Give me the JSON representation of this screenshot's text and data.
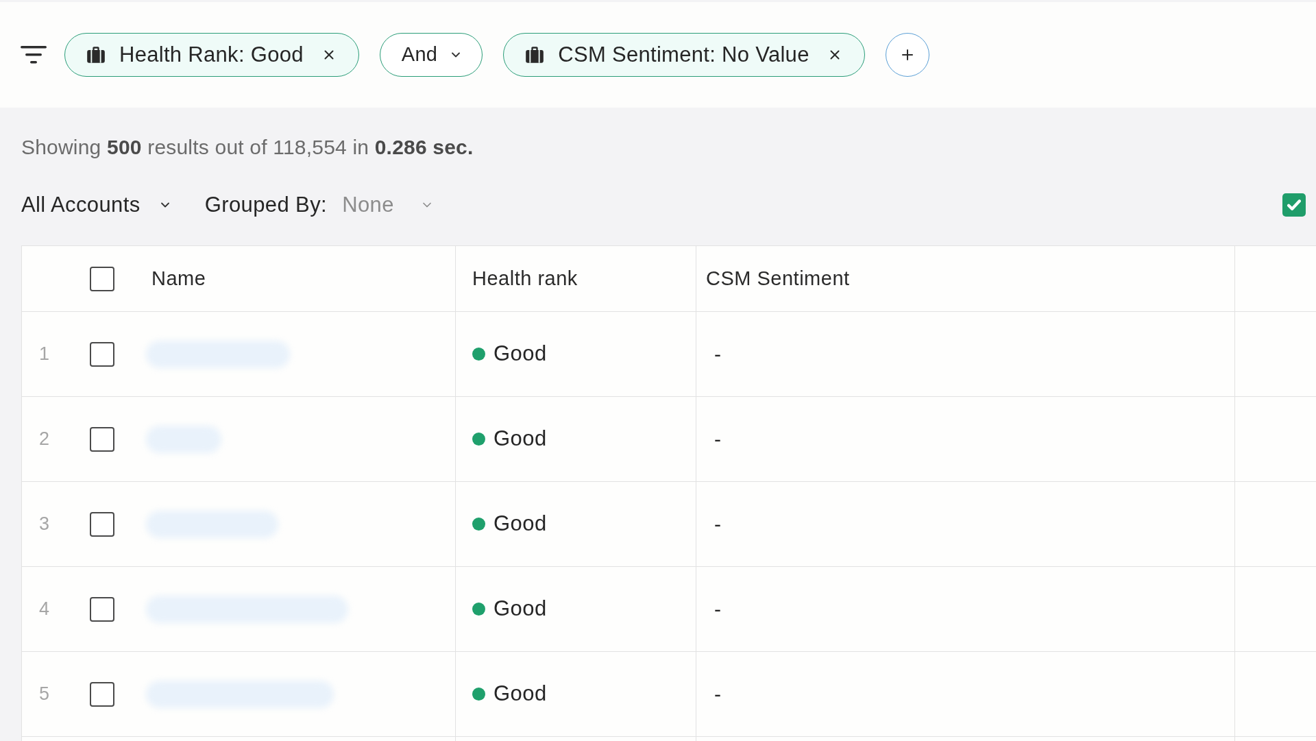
{
  "filter_bar": {
    "filters": [
      {
        "kind": "condition",
        "label": "Health Rank: Good"
      },
      {
        "kind": "operator",
        "label": "And"
      },
      {
        "kind": "condition",
        "label": "CSM Sentiment: No Value"
      }
    ]
  },
  "results_summary": "Showing **500** results out of 118,554 in **0.286 sec.**",
  "view_selector": {
    "label": "All Accounts"
  },
  "grouping": {
    "label": "Grouped By:",
    "value": "None"
  },
  "column_toggle": {
    "checked": true
  },
  "table": {
    "select_all": {
      "checked": false
    },
    "columns": [
      "Name",
      "Health rank",
      "CSM Sentiment"
    ],
    "rows": [
      {
        "index": "1",
        "checked": false,
        "health_rank": {
          "label": "Good",
          "color": "#1fa06c"
        },
        "csm_sentiment": "-"
      },
      {
        "index": "2",
        "checked": false,
        "health_rank": {
          "label": "Good",
          "color": "#1fa06c"
        },
        "csm_sentiment": "-"
      },
      {
        "index": "3",
        "checked": false,
        "health_rank": {
          "label": "Good",
          "color": "#1fa06c"
        },
        "csm_sentiment": "-"
      },
      {
        "index": "4",
        "checked": false,
        "health_rank": {
          "label": "Good",
          "color": "#1fa06c"
        },
        "csm_sentiment": "-"
      },
      {
        "index": "5",
        "checked": false,
        "health_rank": {
          "label": "Good",
          "color": "#1fa06c"
        },
        "csm_sentiment": "-"
      }
    ]
  }
}
